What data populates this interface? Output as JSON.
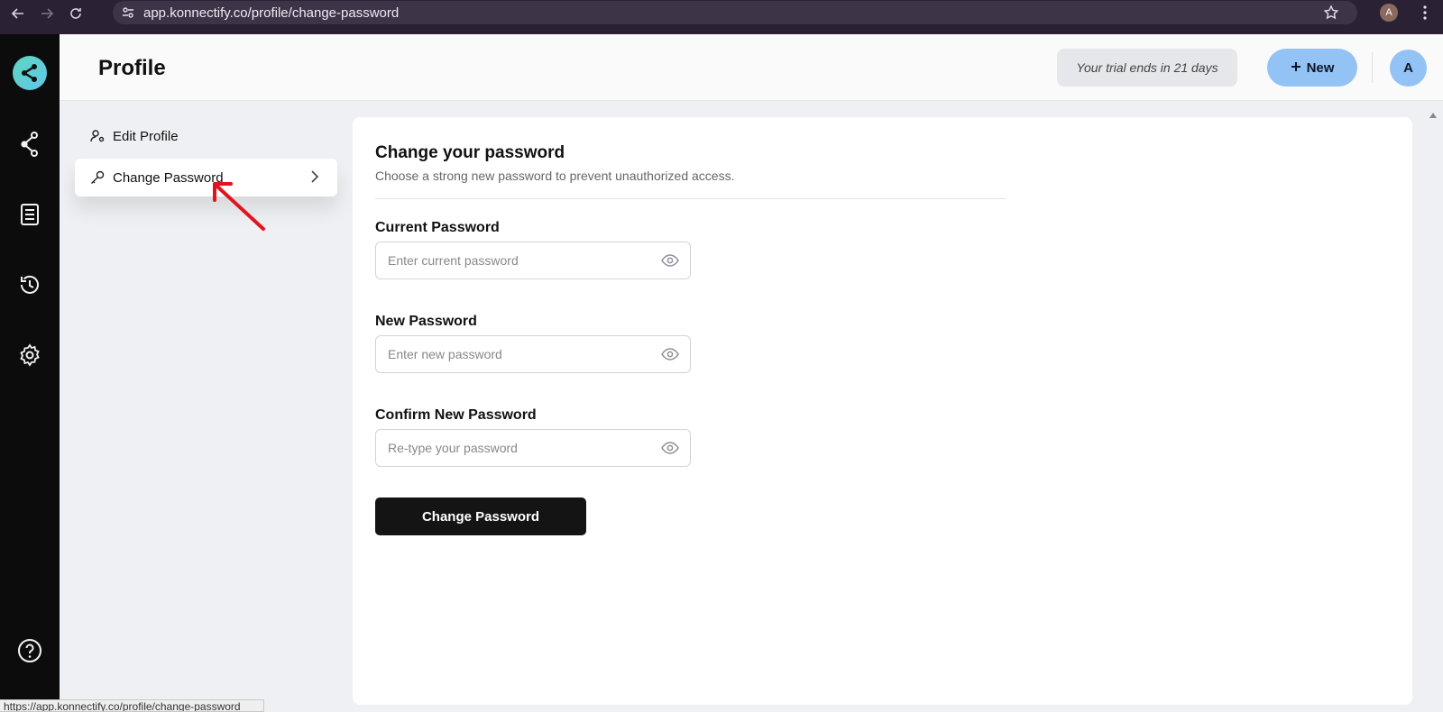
{
  "browser": {
    "url": "app.konnectify.co/profile/change-password",
    "profile_initial": "A"
  },
  "header": {
    "title": "Profile",
    "trial_text": "Your trial ends in 21 days",
    "new_label": "New",
    "avatar_initial": "A"
  },
  "profile_nav": {
    "items": [
      {
        "label": "Edit Profile",
        "icon": "user-edit-icon"
      },
      {
        "label": "Change Password",
        "icon": "key-icon",
        "active": true
      }
    ]
  },
  "form": {
    "title": "Change your password",
    "subtitle": "Choose a strong new password to prevent unauthorized access.",
    "fields": [
      {
        "label": "Current Password",
        "placeholder": "Enter current password"
      },
      {
        "label": "New Password",
        "placeholder": "Enter new password"
      },
      {
        "label": "Confirm New Password",
        "placeholder": "Re-type your password"
      }
    ],
    "submit_label": "Change Password"
  },
  "status_bar": {
    "link_url": "https://app.konnectify.co/profile/change-password"
  },
  "colors": {
    "rail_bg": "#0c0c0c",
    "accent": "#93c2f5",
    "button_dark": "#141414",
    "annotation_arrow": "#e3131e"
  }
}
